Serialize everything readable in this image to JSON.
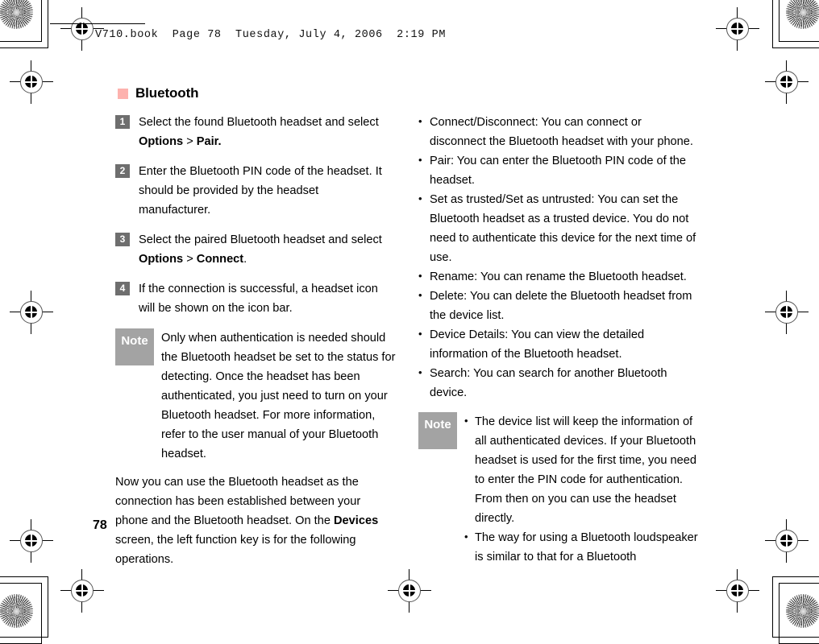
{
  "page_header": {
    "text": "V710.book  Page 78  Tuesday, July 4, 2006  2:19 PM"
  },
  "section": {
    "title": "Bluetooth",
    "bullet_color": "#fdb2ae"
  },
  "colors": {
    "step_box": "#6e6e6e",
    "note_box": "#a3a3a3",
    "text": "#000000"
  },
  "left_column": {
    "steps": [
      {
        "number": "1",
        "text_before": "Select the found Bluetooth headset and select ",
        "bold_1": "Options",
        "text_mid": " > ",
        "bold_2": "Pair.",
        "text_after": ""
      },
      {
        "number": "2",
        "text_before": "Enter the Bluetooth PIN code of the headset. It should be provided by the headset manufacturer.",
        "bold_1": "",
        "text_mid": "",
        "bold_2": "",
        "text_after": ""
      },
      {
        "number": "3",
        "text_before": "Select the paired Bluetooth headset and select ",
        "bold_1": "Options",
        "text_mid": " > ",
        "bold_2": "Connect",
        "text_after": "."
      },
      {
        "number": "4",
        "text_before": "If the connection is successful, a headset icon will be shown on the icon bar.",
        "bold_1": "",
        "text_mid": "",
        "bold_2": "",
        "text_after": ""
      }
    ],
    "note": {
      "label": "Note",
      "body": "Only when authentication is needed should the Bluetooth headset be set to the status for detecting. Once the headset has been authenticated, you just need to turn on your Bluetooth headset. For more information, refer to the user manual of your Bluetooth headset."
    },
    "paragraph": {
      "part1": "Now you can use the Bluetooth headset as the connection has been established between your phone and the Bluetooth headset. On the ",
      "bold": "Devices",
      "part2": " screen, the left function key is for the following operations."
    }
  },
  "right_column": {
    "bullets": [
      "Connect/Disconnect: You can connect or disconnect the Bluetooth headset with your phone.",
      "Pair: You can enter the Bluetooth PIN code of the headset.",
      "Set as trusted/Set as untrusted: You can set the Bluetooth headset as a trusted device. You do not need to authenticate this device for the next time of use.",
      "Rename: You can rename the Bluetooth headset.",
      "Delete: You can delete the Bluetooth headset from the device list.",
      "Device Details: You can view the detailed information of the Bluetooth headset.",
      "Search: You can search for another Bluetooth device."
    ],
    "note": {
      "label": "Note",
      "bullets": [
        "The device list will keep the information of all authenticated devices. If your Bluetooth headset is used for the first time, you need to enter the PIN code for authentication. From then on you can use the headset directly.",
        "The way for using a Bluetooth loudspeaker is similar to that for a Bluetooth"
      ]
    }
  },
  "footer": {
    "page_number": "78"
  }
}
